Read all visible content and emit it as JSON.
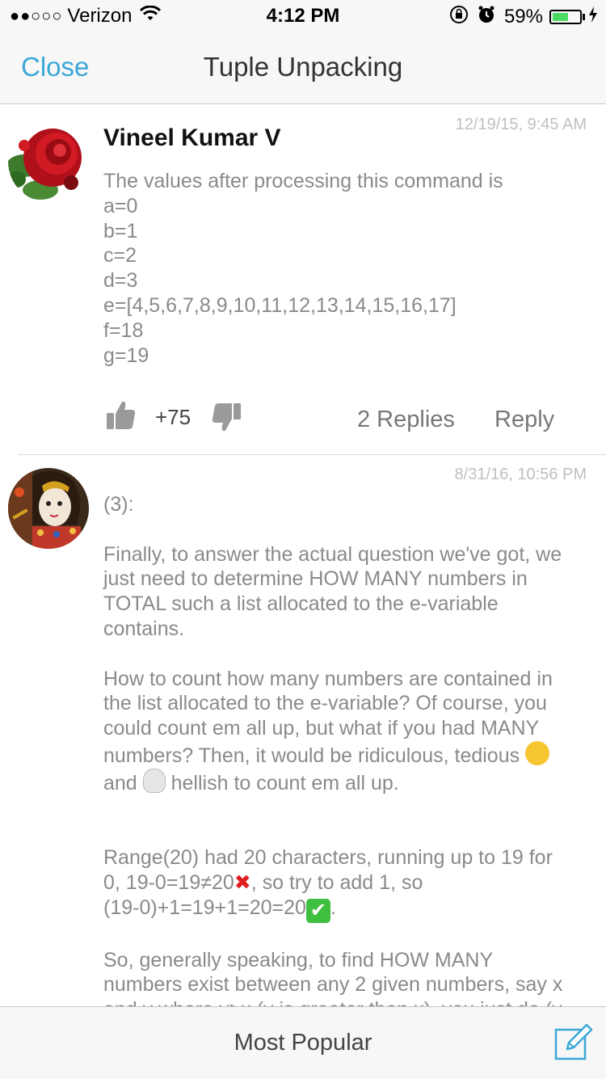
{
  "status_bar": {
    "signal": "●●○○○",
    "carrier": "Verizon",
    "time": "4:12 PM",
    "battery_percent": "59%",
    "battery_level": 0.59,
    "battery_color": "#4cd964"
  },
  "nav": {
    "close_label": "Close",
    "title": "Tuple Unpacking"
  },
  "comments": [
    {
      "author": "Vineel Kumar V",
      "date": "12/19/15, 9:45 AM",
      "lines": [
        "The values after processing this command is",
        "a=0",
        "b=1",
        "c=2",
        "d=3",
        "e=[4,5,6,7,8,9,10,11,12,13,14,15,16,17]",
        "f=18",
        "g=19"
      ],
      "votes": "+75",
      "replies_label": "2 Replies",
      "reply_label": "Reply"
    },
    {
      "author": "",
      "date": "8/31/16, 10:56 PM",
      "intro": "(3):",
      "para1": [
        "Finally, to answer the actual question we've got, we",
        "just need to determine HOW MANY numbers in",
        "TOTAL such a list allocated to the e-variable",
        "contains."
      ],
      "para2": [
        "How to count how many numbers are contained in",
        "the list allocated to the e-variable? Of course, you",
        "could count em all up, but what if you had MANY",
        "numbers? Then, it would be ridiculous, tedious"
      ],
      "para2_last_a": "and",
      "para2_last_b": "hellish to count em all up.",
      "para3_line1": "Range(20) had 20 characters, running up to 19 for",
      "para3_line2a": "0, 19-0=19≠20",
      "para3_line2b": ", so try to add 1, so",
      "para3_line3a": "(19-0)+1=19+1=20=20",
      "para3_line3b": ".",
      "para4": [
        "So, generally speaking, to find HOW MANY",
        "numbers exist between any 2 given numbers, say x",
        "and y where y>x (y is greater than x), you just do (y-"
      ]
    }
  ],
  "bottom": {
    "popular_label": "Most Popular"
  },
  "icons": {
    "wifi": "wifi-icon",
    "rotation_lock": "rotation-lock-icon",
    "alarm": "alarm-icon",
    "thumbs_up": "thumbs-up-icon",
    "thumbs_down": "thumbs-down-icon",
    "compose": "compose-icon"
  },
  "colors": {
    "accent": "#3aa8d6",
    "body_text": "#8a8a8a"
  }
}
